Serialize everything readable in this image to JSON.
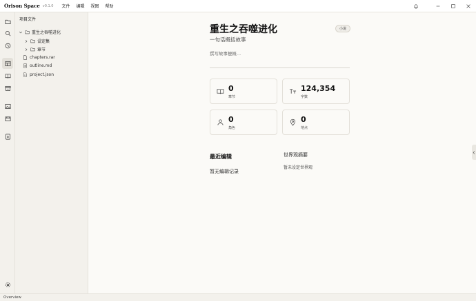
{
  "titlebar": {
    "app_name": "Orison Space",
    "version": "v0.1.0",
    "menus": [
      "文件",
      "编辑",
      "视图",
      "帮助"
    ],
    "icons": [
      "bell-icon",
      "minimize-icon",
      "maximize-icon",
      "close-icon"
    ]
  },
  "activity_bar": {
    "top_icons": [
      "folder-icon",
      "search-icon",
      "history-icon",
      "overview-icon",
      "book-icon",
      "archive-icon",
      "image-icon",
      "film-icon",
      "export-icon"
    ],
    "bottom_icons": [
      "settings-icon"
    ],
    "active": "overview-icon"
  },
  "sidebar": {
    "title": "项目文件",
    "tree": [
      {
        "label": "重生之吞噬进化",
        "type": "folder",
        "expanded": true
      },
      {
        "label": "设定集",
        "type": "folder",
        "expanded": false
      },
      {
        "label": "章节",
        "type": "folder",
        "expanded": false
      },
      {
        "label": "chapters.rar",
        "type": "file"
      },
      {
        "label": "outline.md",
        "type": "file"
      },
      {
        "label": "project.json",
        "type": "file"
      }
    ]
  },
  "book": {
    "title": "重生之吞噬进化",
    "tag": "小说",
    "subtitle": "一句话概括故事",
    "synopsis_placeholder": "撰写故事梗概..."
  },
  "stats": [
    {
      "icon": "book-open-icon",
      "value": "0",
      "label": "章节"
    },
    {
      "icon": "text-size-icon",
      "value": "124,354",
      "label": "字数"
    },
    {
      "icon": "user-icon",
      "value": "0",
      "label": "角色"
    },
    {
      "icon": "map-pin-icon",
      "value": "0",
      "label": "地点"
    }
  ],
  "recent": {
    "title": "最近编辑",
    "empty_text": "暂无编辑记录"
  },
  "world": {
    "title": "世界观摘要",
    "empty_text": "暂未设定世界观"
  },
  "statusbar": {
    "text": "Overview"
  },
  "colors": {
    "background": "#fbfaf7",
    "sidebar": "#f3f1ec",
    "border": "#e4e1da",
    "text": "#222222"
  }
}
